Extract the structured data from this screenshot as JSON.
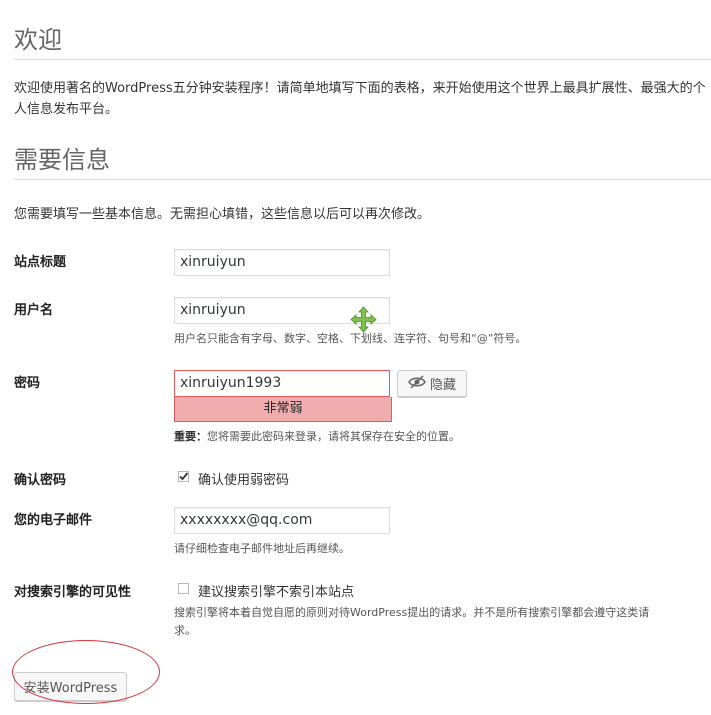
{
  "welcome": {
    "title": "欢迎",
    "intro": "欢迎使用著名的WordPress五分钟安装程序！请简单地填写下面的表格，来开始使用这个世界上最具扩展性、最强大的个人信息发布平台。"
  },
  "info": {
    "title": "需要信息",
    "subtitle": "您需要填写一些基本信息。无需担心填错，这些信息以后可以再次修改。"
  },
  "form": {
    "site_title": {
      "label": "站点标题",
      "value": "xinruiyun"
    },
    "username": {
      "label": "用户名",
      "value": "xinruiyun",
      "hint": "用户名只能含有字母、数字、空格、下划线、连字符、句号和“@”符号。"
    },
    "password": {
      "label": "密码",
      "value": "xinruiyun1993",
      "strength": "非常弱",
      "strength_color": "#f1adad",
      "hide_button": "隐藏",
      "note_bold": "重要：",
      "note": "您将需要此密码来登录，请将其保存在安全的位置。"
    },
    "confirm": {
      "label": "确认密码",
      "checkbox_label": "确认使用弱密码",
      "checked": true
    },
    "email": {
      "label": "您的电子邮件",
      "value": "xxxxxxxx@qq.com",
      "hint": "请仔细检查电子邮件地址后再继续。"
    },
    "privacy": {
      "label": "对搜索引擎的可见性",
      "checkbox_label": "建议搜索引擎不索引本站点",
      "checked": false,
      "hint_line1": "搜索引擎将本着自觉自愿的原则对待WordPress提出的请求。并不是所有搜索引擎都会遵守这类请",
      "hint_line2": "求。"
    }
  },
  "install_button": "安装WordPress",
  "colors": {
    "annotation": "#d9363e",
    "cursor": "#7ec24b",
    "error_border": "#e35b5b"
  }
}
